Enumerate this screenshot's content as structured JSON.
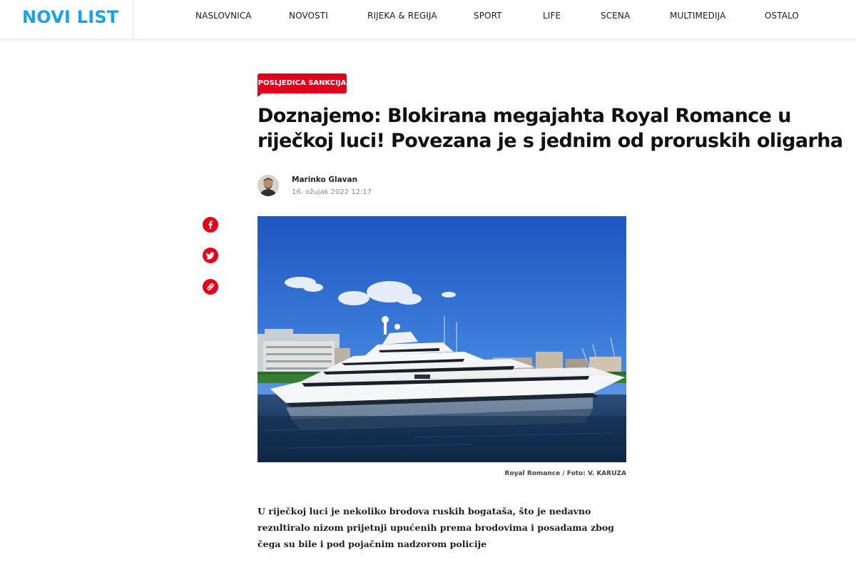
{
  "header": {
    "logo": "NOVI LIST",
    "nav": [
      {
        "label": "NASLOVNICA"
      },
      {
        "label": "NOVOSTI"
      },
      {
        "label": "RIJEKA & REGIJA"
      },
      {
        "label": "SPORT"
      },
      {
        "label": "LIFE"
      },
      {
        "label": "SCENA"
      },
      {
        "label": "MULTIMEDIJA"
      },
      {
        "label": "OSTALO"
      }
    ]
  },
  "article": {
    "category": "POSLJEDICA SANKCIJA",
    "title": "Doznajemo: Blokirana megajahta Royal Romance u riječkoj luci! Povezana je s jednim od proruskih oligarha",
    "author": "Marinko Glavan",
    "date": "16. ožujak 2022 12:17",
    "image_caption": "Royal Romance / Foto: V. KARUZA",
    "lead": "U riječkoj luci je nekoliko brodova ruskih bogataša, što je nedavno rezultiralo nizom prijetnji upućenih prema brodovima i posadama zbog čega su bile i pod pojačnim nadzorom policije"
  },
  "share": [
    {
      "icon": "facebook-icon"
    },
    {
      "icon": "twitter-icon"
    },
    {
      "icon": "link-icon"
    }
  ],
  "colors": {
    "brand": "#1aa3e4",
    "accent": "#e2001a",
    "text": "#111111",
    "muted": "#888888"
  }
}
